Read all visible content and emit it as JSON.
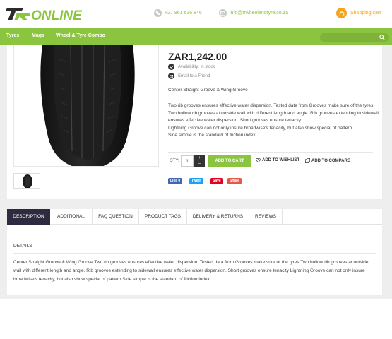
{
  "header": {
    "logo_text": "RONLINE",
    "phone": "+27 861 636 846",
    "email": "info@trwheelandtyre.co.za",
    "cart_label": "Shopping cart"
  },
  "nav": {
    "items": [
      "Tyres",
      "Mags",
      "Wheel & Tyre Combo"
    ],
    "search_placeholder": ""
  },
  "product": {
    "price": "ZAR1,242.00",
    "availability": "Availability: In stock",
    "email_friend": "Email to a Friend",
    "short_desc": "Center Straight Groove & Wing Groove",
    "description_lines": [
      "Two rib grooves ensures effective water dispersion. Tested data from Grooves make sure of the tyres",
      "Two hollow rib grooves at outside wall with different length and angle. Rib grooves extending to sidewall ensures effective water dispersion. Short grooves ensure tenacity",
      "Lightning Groove can not only insure broadwise's tenacity, but also show special of pattern",
      "Side simple is the standard of friction index"
    ],
    "qty_label": "QTY:",
    "qty_value": "1",
    "add_to_cart": "ADD TO CART",
    "add_to_wishlist": "ADD TO WISHLIST",
    "add_to_compare": "ADD TO COMPARE"
  },
  "social": {
    "like": "Like 0",
    "tweet": "Tweet",
    "save": "Save",
    "share": "Share"
  },
  "tabs": [
    "DESCRIPTION",
    "ADDITIONAL",
    "FAQ QUESTION",
    "PRODUCT TAGS",
    "DELIVERY & RETURNS",
    "REVIEWS"
  ],
  "details": {
    "heading": "DETAILS",
    "text": "Center Straight Groove & Wing Groove Two rib grooves ensures effective water dispersion. Tested data from Grooves make sure of the tyres Two hollow rib grooves at outside wall with different length and angle. Rib grooves extending to sidewall ensures effective water dispersion. Short grooves ensure tenacity Lightning Groove can not only insure broadwise's tenacity, but also show special of pattern Side simple is the standard of friction index"
  },
  "colors": {
    "brand_green": "#8bc53f",
    "cart_orange": "#f5a31a",
    "tab_active": "#2e2a3f",
    "facebook": "#4267b2",
    "twitter": "#1da1f2",
    "pinterest": "#e60023",
    "share": "#e05a4a"
  }
}
